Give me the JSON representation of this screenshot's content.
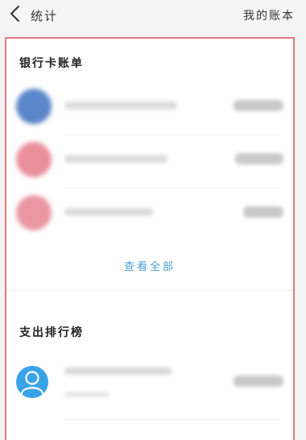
{
  "header": {
    "title": "统计",
    "right_link": "我的账本",
    "back_icon": "chevron-left-icon"
  },
  "bank_section": {
    "title": "银行卡账单",
    "items": [
      {
        "name": "",
        "amount": "",
        "avatar_color": "#5b86c9"
      },
      {
        "name": "",
        "amount": "",
        "avatar_color": "#e9909c"
      },
      {
        "name": "",
        "amount": "",
        "avatar_color": "#ea97a3"
      }
    ],
    "view_all_label": "查看全部"
  },
  "spending_section": {
    "title": "支出排行榜",
    "items": [
      {
        "name": "",
        "subtitle": "",
        "amount": "",
        "avatar_icon": "user-icon",
        "avatar_color": "#3aa3e8"
      }
    ]
  },
  "colors": {
    "accent": "#4e9fd6",
    "highlight_border": "#e1797d"
  }
}
